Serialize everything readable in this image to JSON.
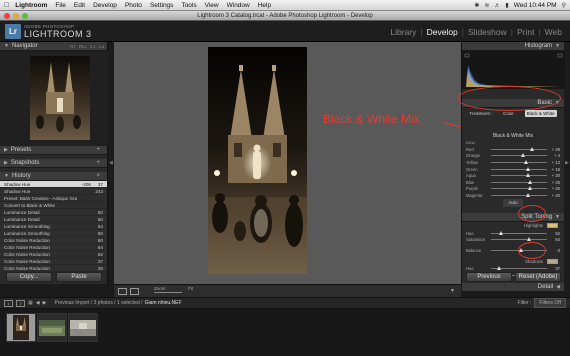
{
  "menubar": {
    "app": "Lightroom",
    "items": [
      "File",
      "Edit",
      "Develop",
      "Photo",
      "Settings",
      "Tools",
      "View",
      "Window",
      "Help"
    ],
    "clock": "Wed 10:44 PM"
  },
  "window": {
    "title": "Lightroom 3 Catalog.lrcat - Adobe Photoshop Lightroom - Develop"
  },
  "identity": {
    "logo": "Lr",
    "adobe": "ADOBE PHOTOSHOP",
    "product": "LIGHTROOM 3"
  },
  "modules": [
    {
      "label": "Library",
      "active": false
    },
    {
      "label": "Develop",
      "active": true
    },
    {
      "label": "Slideshow",
      "active": false
    },
    {
      "label": "Print",
      "active": false
    },
    {
      "label": "Web",
      "active": false
    }
  ],
  "left": {
    "navigator": {
      "title": "Navigator",
      "tools": [
        "FIT",
        "FILL",
        "1:1",
        "1:4"
      ]
    },
    "presets": "Presets",
    "snapshots": "Snapshots",
    "history": {
      "title": "History",
      "items": [
        {
          "name": "Shadow Hue",
          "a": "-206",
          "b": "37",
          "selected": true
        },
        {
          "name": "Shadow Hue",
          "a": "",
          "b": "243",
          "selected": false
        },
        {
          "name": "Preset: B&W Creative - Antique Grays...",
          "a": "",
          "b": "",
          "selected": false
        },
        {
          "name": "Convert to Black & White",
          "a": "",
          "b": "",
          "selected": false
        },
        {
          "name": "Luminance Detail",
          "a": "",
          "b": "50",
          "selected": false
        },
        {
          "name": "Luminance Detail",
          "a": "",
          "b": "60",
          "selected": false
        },
        {
          "name": "Luminance Smoothing",
          "a": "",
          "b": "64",
          "selected": false
        },
        {
          "name": "Luminance Smoothing",
          "a": "",
          "b": "60",
          "selected": false
        },
        {
          "name": "Color Noise Reduction",
          "a": "",
          "b": "60",
          "selected": false
        },
        {
          "name": "Color Noise Reduction",
          "a": "",
          "b": "64",
          "selected": false
        },
        {
          "name": "Color Noise Reduction",
          "a": "",
          "b": "62",
          "selected": false
        },
        {
          "name": "Color Noise Reduction",
          "a": "",
          "b": "37",
          "selected": false
        },
        {
          "name": "Color Noise Reduction",
          "a": "",
          "b": "25",
          "selected": false
        }
      ]
    },
    "copy": "Copy...",
    "paste": "Paste"
  },
  "right": {
    "histogram": "Histogram",
    "basic": {
      "title": "Basic",
      "treatment": "Treatment :",
      "color": "Color",
      "bw": "Black & White"
    },
    "bw_mix": {
      "title": "Black & White Mix",
      "sub": "B&W",
      "rows": [
        {
          "label": "Red",
          "value": "+ 29",
          "pos": 0.7
        },
        {
          "label": "Orange",
          "value": "+ 4",
          "pos": 0.53
        },
        {
          "label": "Yellow",
          "value": "+ 13",
          "pos": 0.59
        },
        {
          "label": "Green",
          "value": "+ 19",
          "pos": 0.62
        },
        {
          "label": "Aqua",
          "value": "+ 20",
          "pos": 0.63
        },
        {
          "label": "Blue",
          "value": "+ 25",
          "pos": 0.66
        },
        {
          "label": "Purple",
          "value": "+ 25",
          "pos": 0.66
        },
        {
          "label": "Magenta",
          "value": "+ 20",
          "pos": 0.63
        }
      ],
      "auto": "Auto"
    },
    "split_toning": {
      "title": "Split Toning",
      "highlights": "Highlights",
      "hi_hue_label": "Hue",
      "hi_hue": "52",
      "hi_sat_label": "Saturation",
      "hi_sat": "64",
      "balance_label": "Balance",
      "balance": "0",
      "shadows": "Shadows",
      "sh_hue_label": "Hue",
      "sh_hue": "37",
      "sh_sat_label": "Saturation",
      "sh_sat": "22",
      "hi_color": "#d9bf7a",
      "sh_color": "#b9aa8e"
    },
    "detail": "Detail",
    "previous": "Previous",
    "reset": "Reset (Adobe)"
  },
  "annotation": {
    "text": "Black & White Mix",
    "color": "#e93a2d"
  },
  "toolbar": {
    "zoom": "Zoom",
    "fit": "Fit"
  },
  "filmstrip": {
    "source": "Previous Import / 3 photos / 1 selected /",
    "filename": "Giam nhieu.NEF",
    "filter_label": "Filter :",
    "filter_value": "Filters Off"
  }
}
